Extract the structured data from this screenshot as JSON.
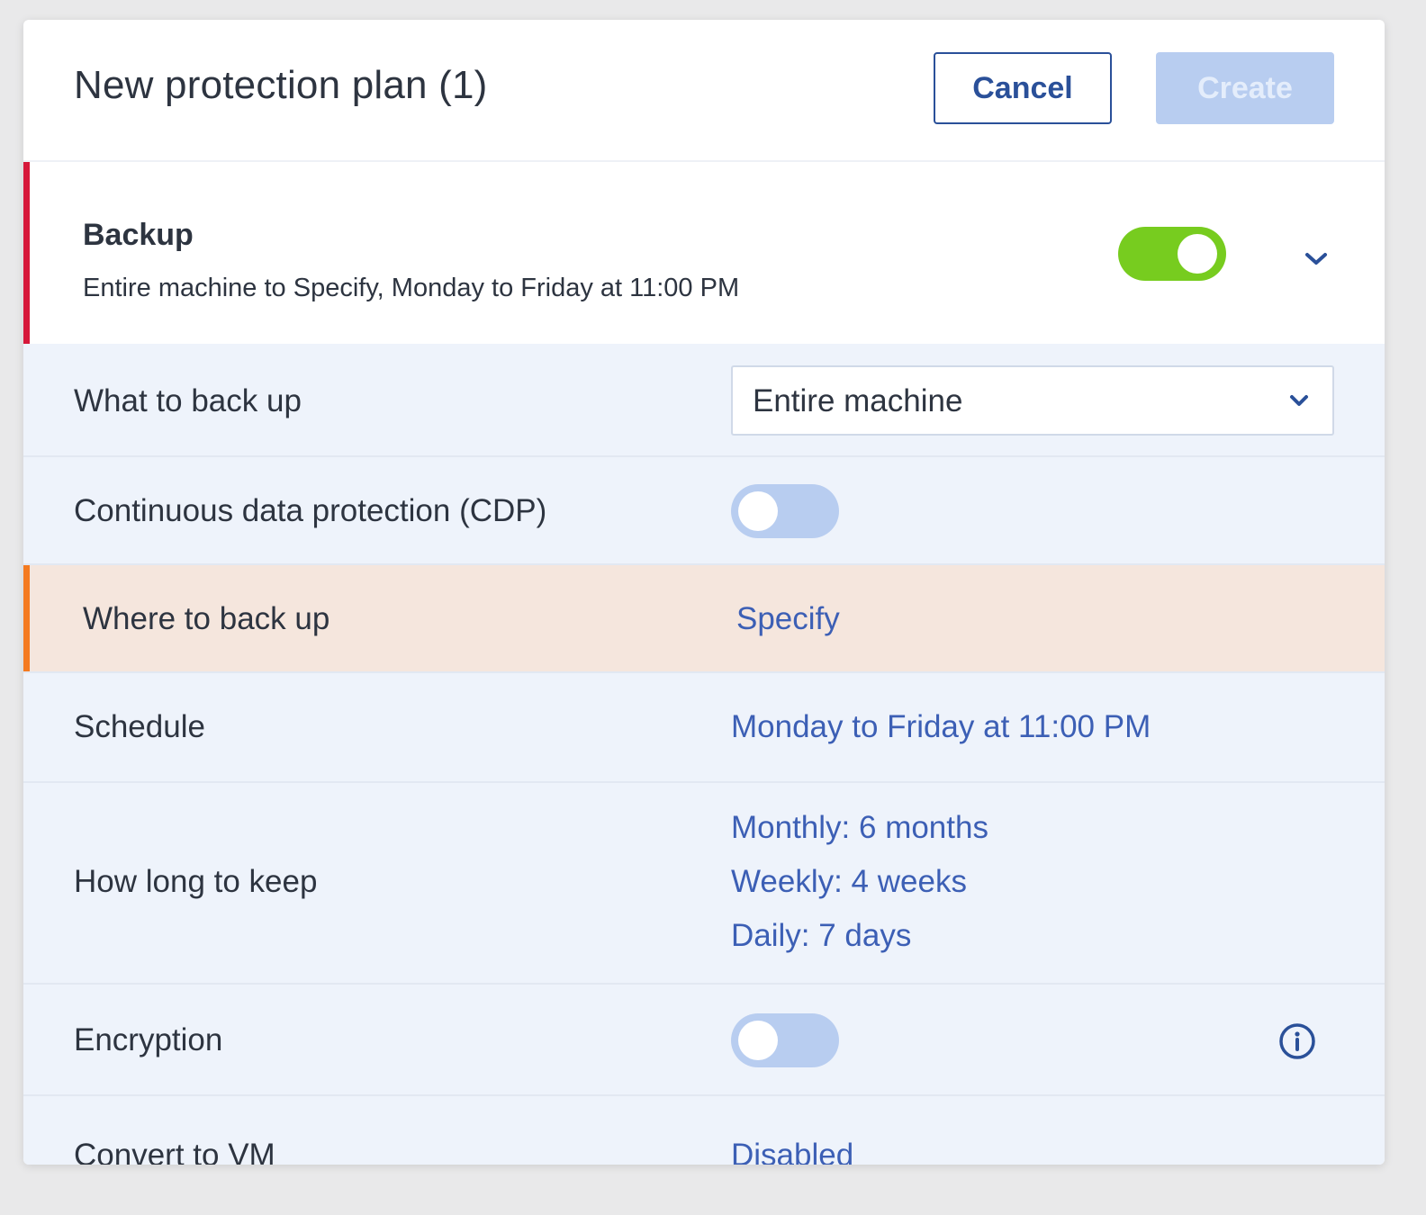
{
  "header": {
    "title": "New protection plan (1)",
    "cancel_label": "Cancel",
    "create_label": "Create"
  },
  "backup": {
    "title": "Backup",
    "summary": "Entire machine to Specify, Monday to Friday at 11:00 PM",
    "enabled": true
  },
  "rows": {
    "what_to_back_up": {
      "label": "What to back up",
      "value": "Entire machine"
    },
    "cdp": {
      "label": "Continuous data protection (CDP)",
      "enabled": false
    },
    "where_to_back_up": {
      "label": "Where to back up",
      "value": "Specify"
    },
    "schedule": {
      "label": "Schedule",
      "value": "Monday to Friday at 11:00 PM"
    },
    "retention": {
      "label": "How long to keep",
      "monthly": "Monthly: 6 months",
      "weekly": "Weekly: 4 weeks",
      "daily": "Daily: 7 days"
    },
    "encryption": {
      "label": "Encryption",
      "enabled": false
    },
    "convert_to_vm": {
      "label": "Convert to VM",
      "value": "Disabled"
    }
  },
  "colors": {
    "accent": "#2a5099",
    "link": "#3c5fb5",
    "toggle_on": "#77cc1f",
    "toggle_off": "#b8cdf0",
    "error_bar": "#d6183a",
    "warning_bar": "#f47a20"
  }
}
